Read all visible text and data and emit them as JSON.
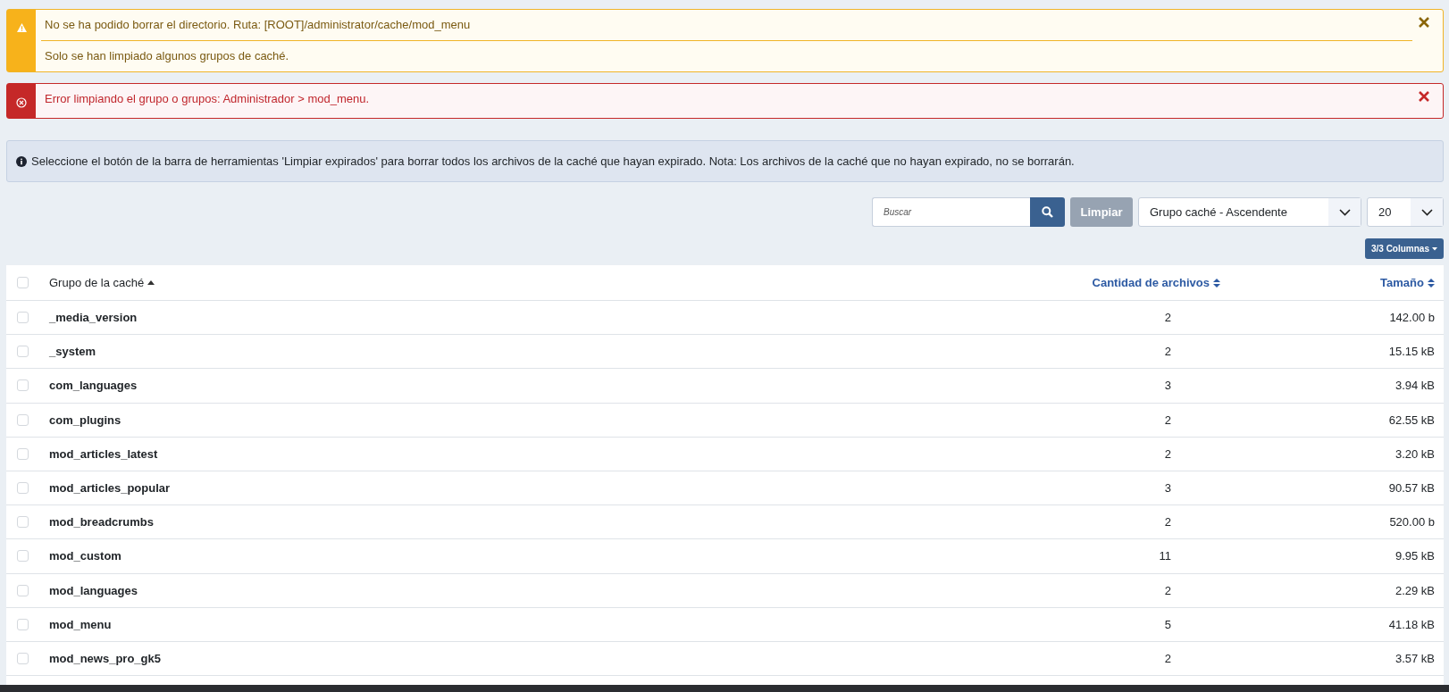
{
  "alerts": [
    {
      "kind": "warning",
      "messages": [
        "No se ha podido borrar el directorio. Ruta: [ROOT]/administrator/cache/mod_menu",
        "Solo se han limpiado algunos grupos de caché."
      ]
    },
    {
      "kind": "error",
      "messages": [
        "Error limpiando el grupo o grupos: Administrador > mod_menu."
      ]
    }
  ],
  "info": "Seleccione el botón de la barra de herramientas 'Limpiar expirados' para borrar todos los archivos de la caché que hayan expirado. Nota: Los archivos de la caché que no hayan expirado, no se borrarán.",
  "toolbar": {
    "search": {
      "placeholder": "Buscar"
    },
    "clear_button": "Limpiar",
    "clear_disabled": true,
    "ordering": "Grupo caché - Ascendente",
    "limit": "20",
    "columns_button": "3/3 Columnas"
  },
  "table": {
    "select_all": false,
    "columns": [
      {
        "label": "Grupo de la caché",
        "sorted": true
      },
      {
        "label": "Cantidad de archivos",
        "sorted": false
      },
      {
        "label": "Tamaño",
        "sorted": false
      }
    ],
    "rows": [
      {
        "group": "_media_version",
        "count": "2",
        "size": "142.00 b",
        "selected": false
      },
      {
        "group": "_system",
        "count": "2",
        "size": "15.15 kB",
        "selected": false
      },
      {
        "group": "com_languages",
        "count": "3",
        "size": "3.94 kB",
        "selected": false
      },
      {
        "group": "com_plugins",
        "count": "2",
        "size": "62.55 kB",
        "selected": false
      },
      {
        "group": "mod_articles_latest",
        "count": "2",
        "size": "3.20 kB",
        "selected": false
      },
      {
        "group": "mod_articles_popular",
        "count": "3",
        "size": "90.57 kB",
        "selected": false
      },
      {
        "group": "mod_breadcrumbs",
        "count": "2",
        "size": "520.00 b",
        "selected": false
      },
      {
        "group": "mod_custom",
        "count": "11",
        "size": "9.95 kB",
        "selected": false
      },
      {
        "group": "mod_languages",
        "count": "2",
        "size": "2.29 kB",
        "selected": false
      },
      {
        "group": "mod_menu",
        "count": "5",
        "size": "41.18 kB",
        "selected": false
      },
      {
        "group": "mod_news_pro_gk5",
        "count": "2",
        "size": "3.57 kB",
        "selected": false
      }
    ]
  }
}
